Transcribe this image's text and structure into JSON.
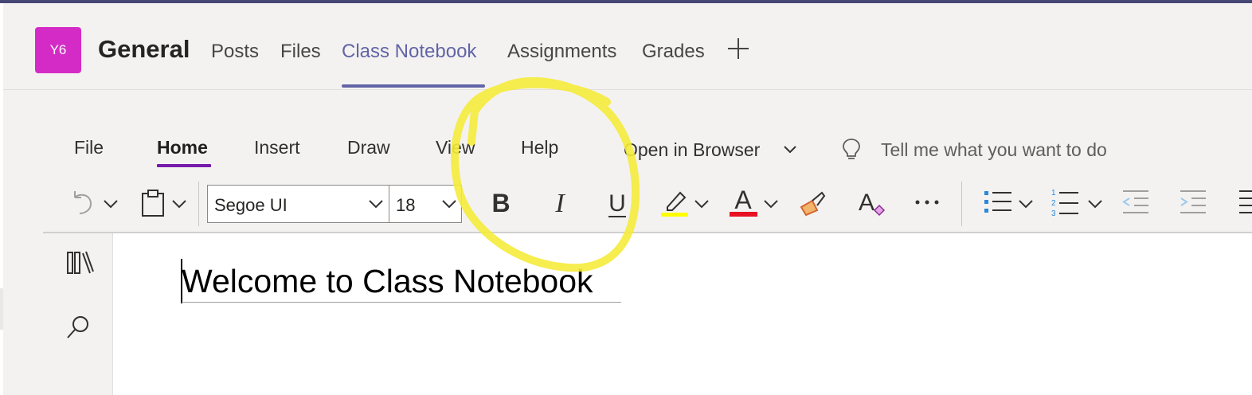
{
  "team": {
    "avatar_initials": "Y6",
    "avatar_color": "#d52bc6"
  },
  "channel": {
    "name": "General",
    "tabs": [
      {
        "label": "Posts"
      },
      {
        "label": "Files"
      },
      {
        "label": "Class Notebook",
        "active": true
      },
      {
        "label": "Assignments"
      },
      {
        "label": "Grades"
      }
    ],
    "add_tab_icon": "plus-icon"
  },
  "ribbon": {
    "tabs": [
      {
        "label": "File"
      },
      {
        "label": "Home",
        "active": true
      },
      {
        "label": "Insert"
      },
      {
        "label": "Draw"
      },
      {
        "label": "View"
      },
      {
        "label": "Help"
      }
    ],
    "open_in_browser": "Open in Browser",
    "tell_me": "Tell me what you want to do",
    "font_name": "Segoe UI",
    "font_size": "18",
    "highlight_color": "#ffff00",
    "font_color": "#e81123"
  },
  "page": {
    "title": "Welcome to Class Notebook"
  },
  "colors": {
    "accent": "#6264a7",
    "ribbon_accent": "#7719aa",
    "annotation": "#f5eb3b"
  }
}
